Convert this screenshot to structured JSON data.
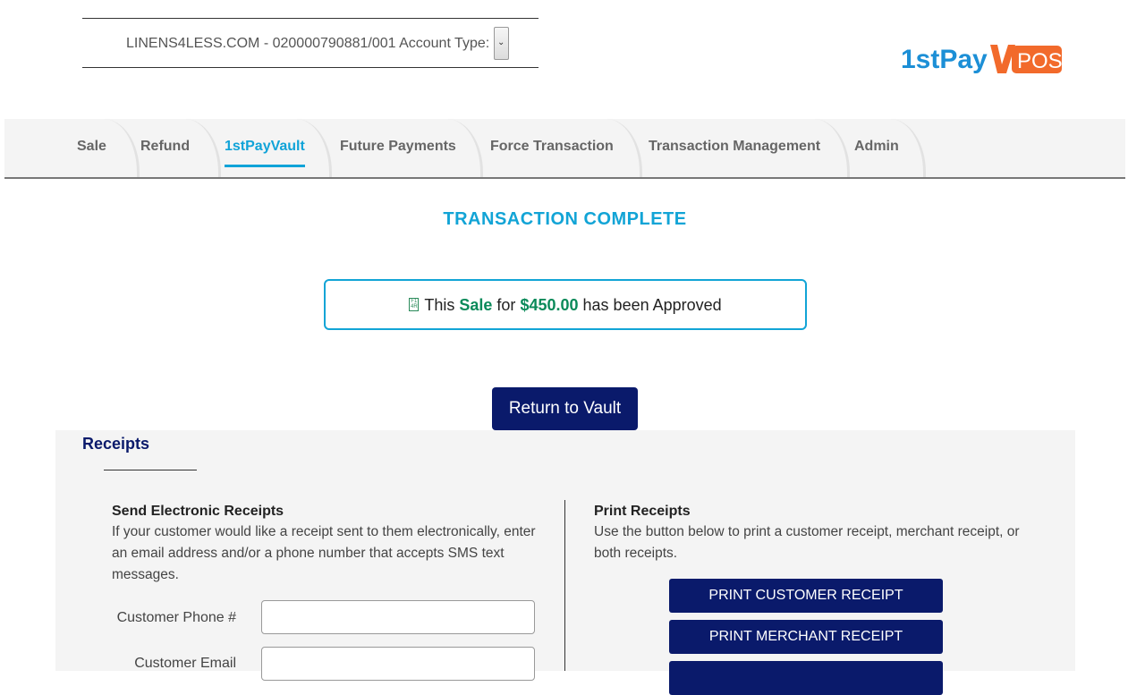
{
  "header": {
    "account_text": "LINENS4LESS.COM - 020000790881/001 Account Type:",
    "logo": {
      "part1": "1stPay",
      "part2": "POS"
    }
  },
  "nav": {
    "tabs": [
      {
        "label": "Sale"
      },
      {
        "label": "Refund"
      },
      {
        "label": "1stPayVault"
      },
      {
        "label": "Future Payments"
      },
      {
        "label": "Force Transaction"
      },
      {
        "label": "Transaction Management"
      },
      {
        "label": "Admin"
      }
    ],
    "active_tab": "1stPayVault"
  },
  "status": {
    "title": "TRANSACTION COMPLETE",
    "approval": {
      "prefix": "This",
      "type": "Sale",
      "middle": "for",
      "amount": "$450.00",
      "suffix": "has been Approved"
    }
  },
  "actions": {
    "return_label": "Return to Vault"
  },
  "receipts": {
    "title": "Receipts",
    "electronic": {
      "title": "Send Electronic Receipts",
      "description": "If your customer would like a receipt sent to them electronically, enter an email address and/or a phone number that accepts SMS text messages.",
      "phone_label": "Customer Phone #",
      "phone_value": "",
      "email_label": "Customer Email",
      "email_value": ""
    },
    "print": {
      "title": "Print Receipts",
      "description": "Use the button below to print a customer receipt, merchant receipt, or both receipts.",
      "customer_button": "PRINT CUSTOMER RECEIPT",
      "merchant_button": "PRINT MERCHANT RECEIPT"
    }
  },
  "colors": {
    "accent": "#12a4d6",
    "navy": "#0a1a6b",
    "approved_green": "#0a8a5a",
    "logo_orange": "#f26a2b"
  }
}
